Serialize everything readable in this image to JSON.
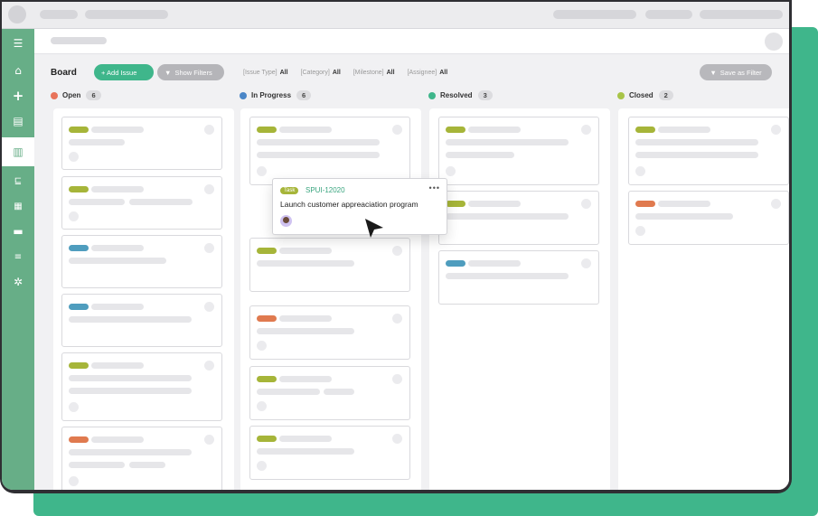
{
  "board": {
    "title": "Board",
    "add_issue_label": "+ Add Issue",
    "show_filters_label": "Show Filters",
    "save_filter_label": "Save as Filter"
  },
  "filters": [
    {
      "label": "[Issue Type]",
      "value": "All"
    },
    {
      "label": "[Category]",
      "value": "All"
    },
    {
      "label": "[Milestone]",
      "value": "All"
    },
    {
      "label": "[Assignee]",
      "value": "All"
    }
  ],
  "columns": [
    {
      "name": "Open",
      "count": "6",
      "color": "#e8735a"
    },
    {
      "name": "In Progress",
      "count": "6",
      "color": "#4a86c7"
    },
    {
      "name": "Resolved",
      "count": "3",
      "color": "#3fb68b"
    },
    {
      "name": "Closed",
      "count": "2",
      "color": "#a8c448"
    }
  ],
  "colors": {
    "accent": "#3fb68b",
    "sidebar": "#67ae87",
    "tag_green": "#a6b539",
    "tag_blue": "#4f9dbe",
    "tag_orange": "#e07a4f"
  },
  "floating_card": {
    "type": "Task",
    "id": "SPUI-12020",
    "more": "•••",
    "title": "Launch customer appreaciation program"
  },
  "icons": {
    "sidebar": [
      "menu-icon",
      "home-icon",
      "add-icon",
      "list-icon",
      "board-icon",
      "gantt-icon",
      "wiki-icon",
      "files-icon",
      "git-icon",
      "settings-icon"
    ]
  }
}
